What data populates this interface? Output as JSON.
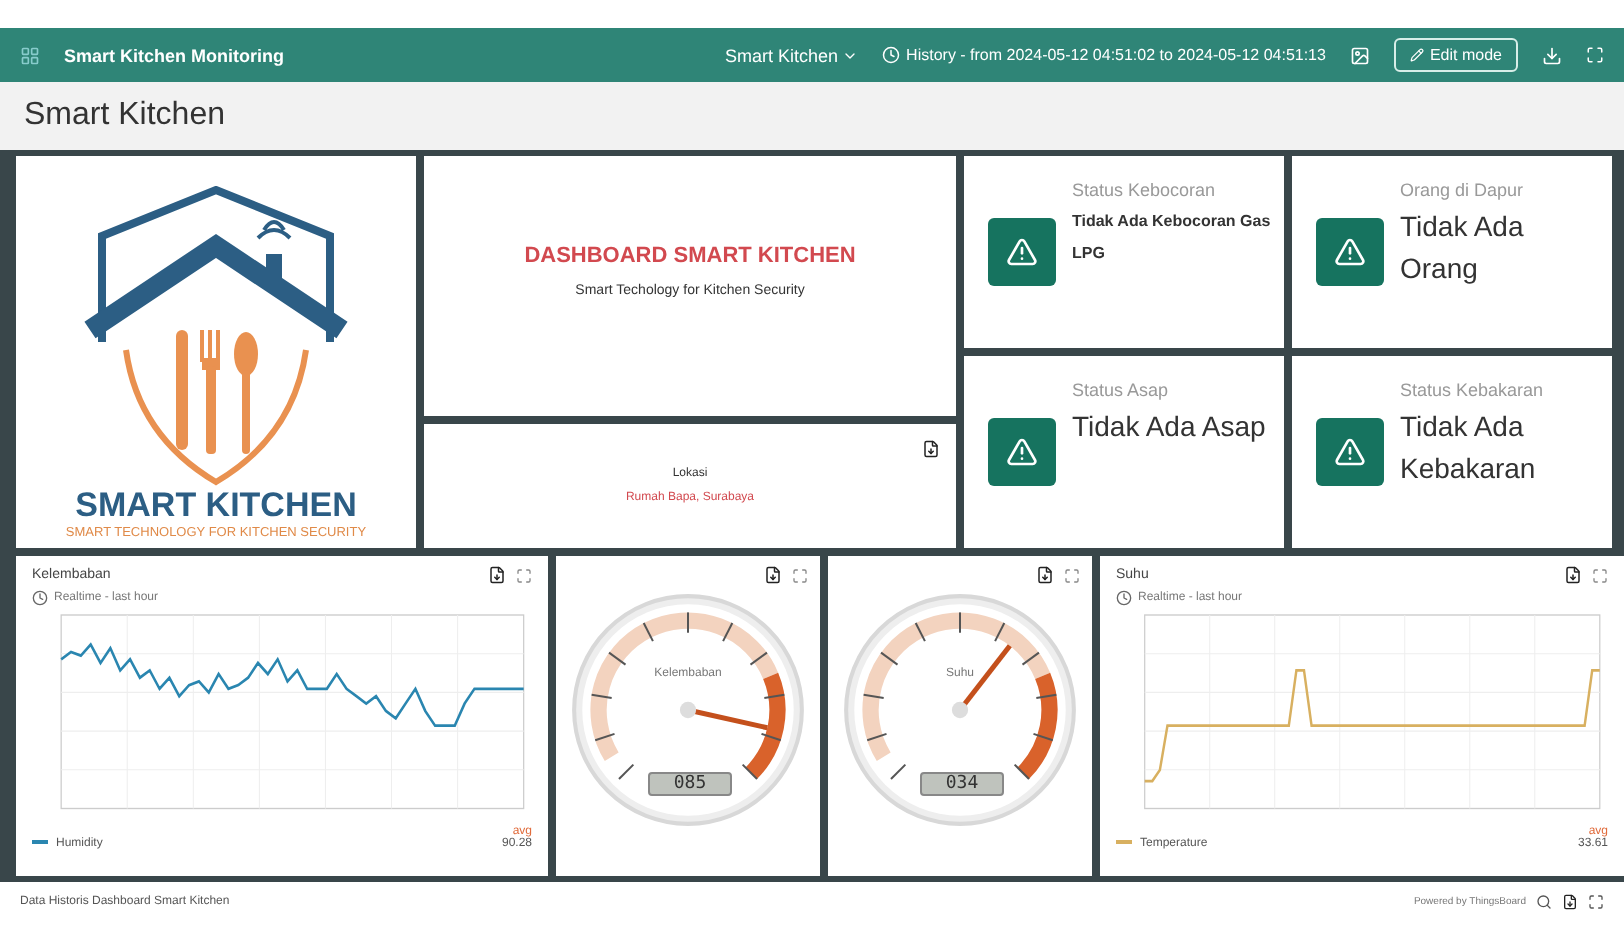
{
  "header": {
    "title": "Smart Kitchen Monitoring",
    "dashboard_select": "Smart Kitchen",
    "history": "History - from 2024-05-12 04:51:02 to 2024-05-12 04:51:13",
    "edit_button": "Edit mode"
  },
  "page_title": "Smart Kitchen",
  "logo": {
    "title": "SMART KITCHEN",
    "tagline": "SMART TECHNOLOGY FOR KITCHEN SECURITY"
  },
  "intro": {
    "title": "DASHBOARD SMART KITCHEN",
    "subtitle": "Smart Techology for Kitchen Security"
  },
  "location": {
    "label": "Lokasi",
    "value": "Rumah Bapa, Surabaya"
  },
  "status_cards": [
    {
      "title": "Status Kebocoran",
      "value": "Tidak Ada Kebocoran Gas LPG",
      "kind": "compact"
    },
    {
      "title": "Orang di Dapur",
      "value": "Tidak Ada Orang",
      "kind": "large"
    },
    {
      "title": "Status Asap",
      "value": "Tidak Ada Asap",
      "kind": "large"
    },
    {
      "title": "Status Kebakaran",
      "value": "Tidak Ada Kebakaran",
      "kind": "large"
    }
  ],
  "widgets": [
    {
      "kind": "chart",
      "title": "Kelembaban",
      "subtitle": "Realtime - last hour",
      "legend": "Humidity",
      "stat_label": "avg",
      "stat_value": "90.28",
      "color": "#2a86b0"
    },
    {
      "kind": "gauge",
      "label": "Kelembaban",
      "reading": "085"
    },
    {
      "kind": "gauge",
      "label": "Suhu",
      "reading": "034"
    },
    {
      "kind": "chart",
      "title": "Suhu",
      "subtitle": "Realtime - last hour",
      "legend": "Temperature",
      "stat_label": "avg",
      "stat_value": "33.61",
      "color": "#d8b060"
    }
  ],
  "footer": {
    "title": "Data Historis Dashboard Smart Kitchen",
    "powered": "Powered by ThingsBoard"
  }
}
